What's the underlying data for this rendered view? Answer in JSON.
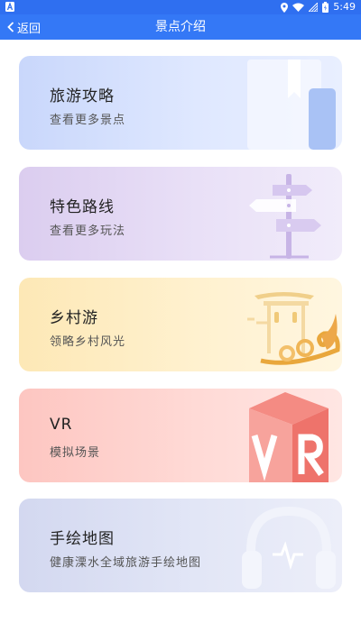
{
  "status_bar": {
    "time": "5:49"
  },
  "nav": {
    "back_label": "返回",
    "title": "景点介绍"
  },
  "cards": [
    {
      "title": "旅游攻略",
      "subtitle": "查看更多景点",
      "icon": "book-icon"
    },
    {
      "title": "特色路线",
      "subtitle": "查看更多玩法",
      "icon": "signpost-icon"
    },
    {
      "title": "乡村游",
      "subtitle": "领略乡村风光",
      "icon": "pavilion-cloud-icon"
    },
    {
      "title": "VR",
      "subtitle": "模拟场景",
      "icon": "vr-cube-icon"
    },
    {
      "title": "手绘地图",
      "subtitle": "健康溧水全域旅游手绘地图",
      "icon": "headphones-icon"
    }
  ],
  "colors": {
    "status_bar": "#2f6ff0",
    "nav_bar": "#3478f6"
  }
}
